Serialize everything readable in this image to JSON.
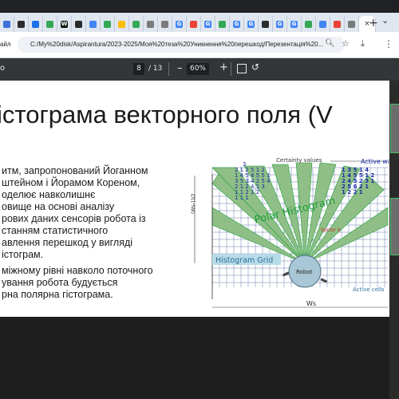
{
  "browser": {
    "tab_favicons": [
      {
        "color": "#3c6fd8",
        "glyph": ""
      },
      {
        "color": "#2b2b2b",
        "glyph": ""
      },
      {
        "color": "#1a73e8",
        "glyph": ""
      },
      {
        "color": "#34a853",
        "glyph": ""
      },
      {
        "color": "#111111",
        "glyph": "W"
      },
      {
        "color": "#2b2b2b",
        "glyph": ""
      },
      {
        "color": "#4285f4",
        "glyph": ""
      },
      {
        "color": "#34a853",
        "glyph": ""
      },
      {
        "color": "#fbbc04",
        "glyph": ""
      },
      {
        "color": "#34a853",
        "glyph": ""
      },
      {
        "color": "#7b7b7b",
        "glyph": ""
      },
      {
        "color": "#7b7b7b",
        "glyph": ""
      },
      {
        "color": "#4285f4",
        "glyph": "G"
      },
      {
        "color": "#ea4335",
        "glyph": ""
      },
      {
        "color": "#4285f4",
        "glyph": "G"
      },
      {
        "color": "#34a853",
        "glyph": ""
      },
      {
        "color": "#4285f4",
        "glyph": "G"
      },
      {
        "color": "#4285f4",
        "glyph": "G"
      },
      {
        "color": "#2b2b2b",
        "glyph": ""
      },
      {
        "color": "#4285f4",
        "glyph": "G"
      },
      {
        "color": "#4285f4",
        "glyph": "G"
      },
      {
        "color": "#34a853",
        "glyph": ""
      },
      {
        "color": "#4285f4",
        "glyph": ""
      },
      {
        "color": "#ea4335",
        "glyph": ""
      },
      {
        "color": "#7b7b7b",
        "glyph": ""
      }
    ],
    "active_tab_close": "×",
    "new_tab": "+",
    "tabs_menu": "⌄",
    "address_left_label": "айл",
    "url": "C:/My%20disk/Aspirantura/2023-2025/Моя%20теза%20Уникнення%20перешкод/Перезентація%20...",
    "icons": {
      "zoom": "search-icon",
      "star": "star-icon",
      "download": "download-icon",
      "menu": "menu-icon"
    }
  },
  "pdf_toolbar": {
    "title_fragment": "o",
    "current_page": "8",
    "total_pages": "/ 13",
    "zoom_minus": "–",
    "zoom": "60%",
    "zoom_plus": "+"
  },
  "slide": {
    "title": "істограма векторного поля (V",
    "body_lines": [
      "итм,  запропонований Йоганном",
      "штейном і Йорамом Кореном,",
      "оделює навколишнє",
      "овище на основі аналізу",
      "рових даних сенсорів робота із",
      "станням статистичного",
      "авлення перешкод у вигляді",
      "істограм.",
      "міжному рівні навколо поточного",
      "ування робота будується",
      "рна полярна гістограма."
    ],
    "figure": {
      "certainty_label": "Certainty values",
      "active_window_label": "Active wi",
      "polar_label": "Polar Histogram",
      "sector_label": "Sector k",
      "grid_label": "Histogram Grid",
      "robot_label": "Robot",
      "active_cells_label": "Active cells",
      "ws_label": "Ws",
      "axis_label": "(Ws-1)/2",
      "grid_numbers": [
        {
          "text": "3",
          "col": "#1b2ba6"
        },
        {
          "text": "2 1 2 5 1 2",
          "col": "#1b2ba6"
        },
        {
          "text": "1 4 5 4 5 5 1",
          "col": "#1b2ba6"
        },
        {
          "text": "3 5 3 4 2 5 4",
          "col": "#1b2ba6"
        },
        {
          "text": "2 1 2 4 1 3",
          "col": "#1b2ba6"
        },
        {
          "text": "1 1 2 1 2",
          "col": "#1b2ba6"
        },
        {
          "text": "1 1 1",
          "col": "#1b2ba6"
        }
      ],
      "grid_numbers_right": [
        "1 3 5 1 4",
        "1 4 5 5 1 2",
        "2 4 5 2 3 1",
        "2 5 6 2 1",
        "1 2 2 1"
      ]
    }
  },
  "colors": {
    "accent_green": "#1f9e3c",
    "grid_blue": "#6a7ea9",
    "ray_green": "#8fbf86",
    "robot_fill": "#a8c6d6"
  }
}
